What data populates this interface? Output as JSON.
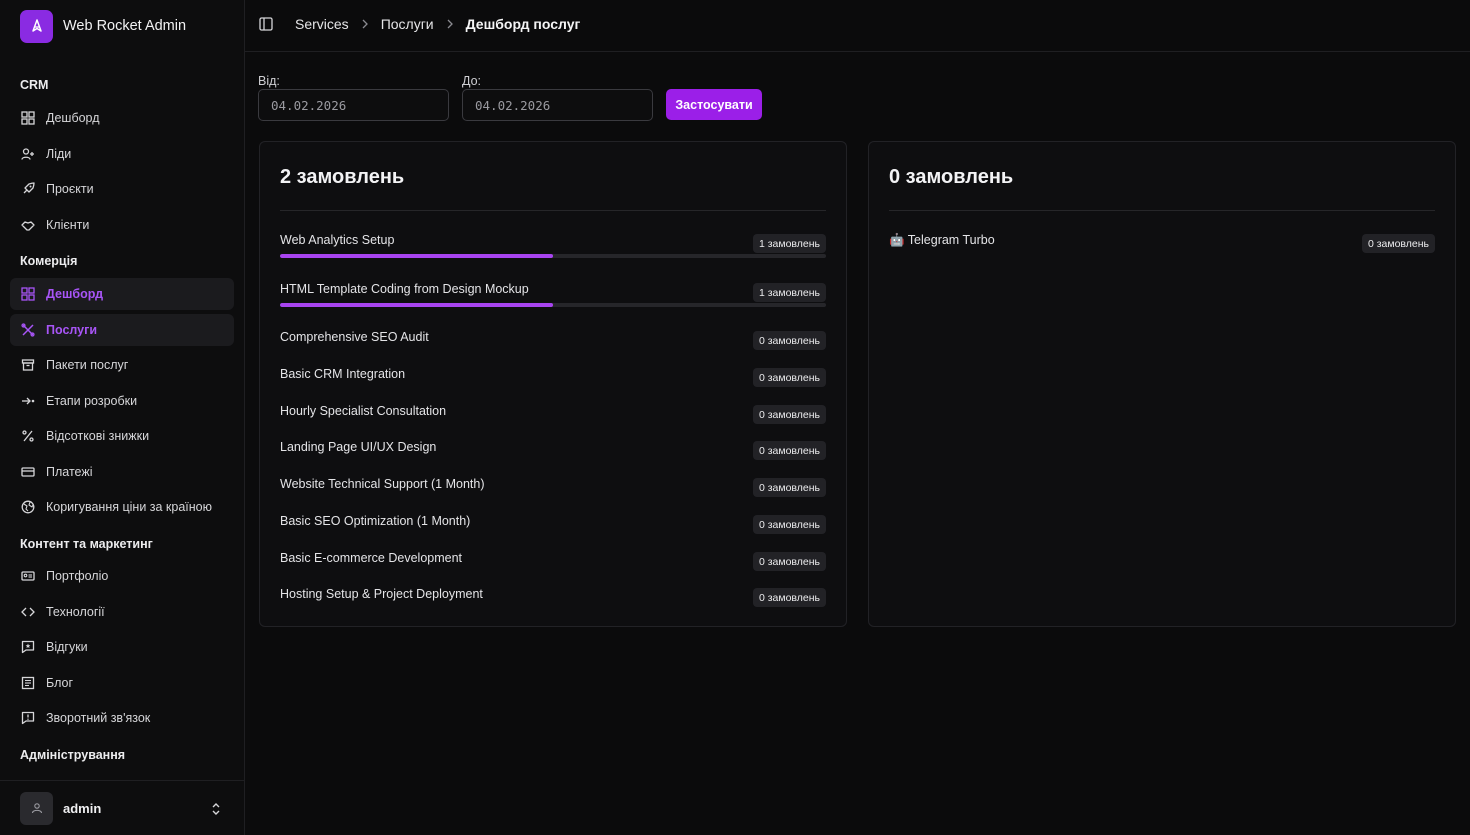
{
  "app": {
    "title": "Web Rocket Admin"
  },
  "sidebar": {
    "sections": [
      {
        "label": "CRM",
        "items": [
          {
            "label": "Дешборд",
            "icon": "dashboard-icon"
          },
          {
            "label": "Ліди",
            "icon": "users-icon"
          },
          {
            "label": "Проєкти",
            "icon": "rocket-icon"
          },
          {
            "label": "Клієнти",
            "icon": "handshake-icon"
          }
        ]
      },
      {
        "label": "Комерція",
        "items": [
          {
            "label": "Дешборд",
            "icon": "dashboard-icon",
            "active": true
          },
          {
            "label": "Послуги",
            "icon": "tools-icon",
            "active": true
          },
          {
            "label": "Пакети послуг",
            "icon": "package-icon"
          },
          {
            "label": "Етапи розробки",
            "icon": "steps-icon"
          },
          {
            "label": "Відсоткові знижки",
            "icon": "percent-icon"
          },
          {
            "label": "Платежі",
            "icon": "credit-card-icon"
          },
          {
            "label": "Коригування ціни за країною",
            "icon": "globe-icon"
          }
        ]
      },
      {
        "label": "Контент та маркетинг",
        "items": [
          {
            "label": "Портфоліо",
            "icon": "portfolio-icon"
          },
          {
            "label": "Технології",
            "icon": "code-icon"
          },
          {
            "label": "Відгуки",
            "icon": "review-icon"
          },
          {
            "label": "Блог",
            "icon": "blog-icon"
          },
          {
            "label": "Зворотний зв'язок",
            "icon": "feedback-icon"
          }
        ]
      },
      {
        "label": "Адміністрування",
        "items": []
      }
    ],
    "user": {
      "name": "admin"
    }
  },
  "header": {
    "breadcrumbs": [
      "Services",
      "Послуги",
      "Дешборд послуг"
    ]
  },
  "filters": {
    "from_label": "Від:",
    "from_value": "04.02.2026",
    "to_label": "До:",
    "to_value": "04.02.2026",
    "apply_label": "Застосувати"
  },
  "colors": {
    "accent": "#9b1fe8",
    "progress": "#a844f0"
  },
  "cards": [
    {
      "title": "2 замовлень",
      "rows": [
        {
          "name": "Web Analytics Setup",
          "count": "1 замовлень",
          "share": 0.5
        },
        {
          "name": "HTML Template Coding from Design Mockup",
          "count": "1 замовлень",
          "share": 0.5
        },
        {
          "name": "Comprehensive SEO Audit",
          "count": "0 замовлень",
          "share": 0
        },
        {
          "name": "Basic CRM Integration",
          "count": "0 замовлень",
          "share": 0
        },
        {
          "name": "Hourly Specialist Consultation",
          "count": "0 замовлень",
          "share": 0
        },
        {
          "name": "Landing Page UI/UX Design",
          "count": "0 замовлень",
          "share": 0
        },
        {
          "name": "Website Technical Support (1 Month)",
          "count": "0 замовлень",
          "share": 0
        },
        {
          "name": "Basic SEO Optimization (1 Month)",
          "count": "0 замовлень",
          "share": 0
        },
        {
          "name": "Basic E-commerce Development",
          "count": "0 замовлень",
          "share": 0
        },
        {
          "name": "Hosting Setup & Project Deployment",
          "count": "0 замовлень",
          "share": 0
        }
      ]
    },
    {
      "title": "0 замовлень",
      "rows": [
        {
          "name": "🤖 Telegram Turbo",
          "count": "0 замовлень",
          "share": 0
        }
      ]
    }
  ]
}
